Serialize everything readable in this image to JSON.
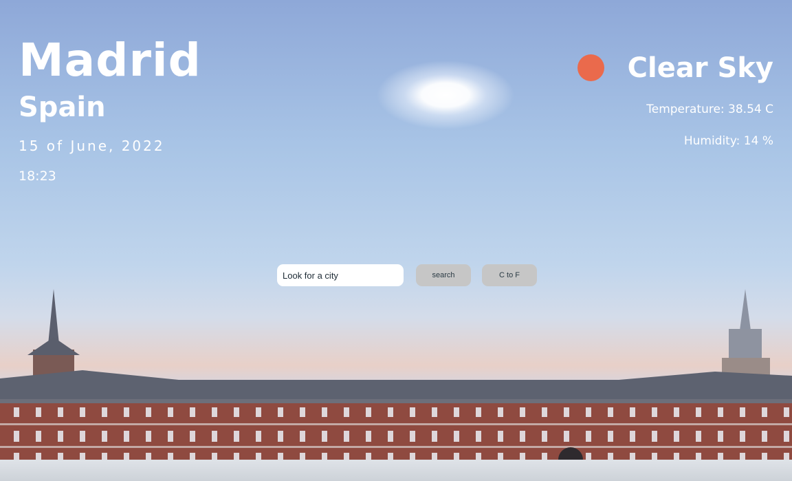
{
  "location": {
    "city": "Madrid",
    "country": "Spain",
    "date": "15 of June, 2022",
    "time": "18:23"
  },
  "weather": {
    "condition": "Clear Sky",
    "temperature": "Temperature: 38.54 C",
    "humidity": "Humidity: 14 %",
    "indicator_color": "#ea6a4c"
  },
  "controls": {
    "search_value": "Look for a city",
    "search_placeholder": "Look for a city",
    "search_button": "search",
    "unit_button": "C to F"
  }
}
